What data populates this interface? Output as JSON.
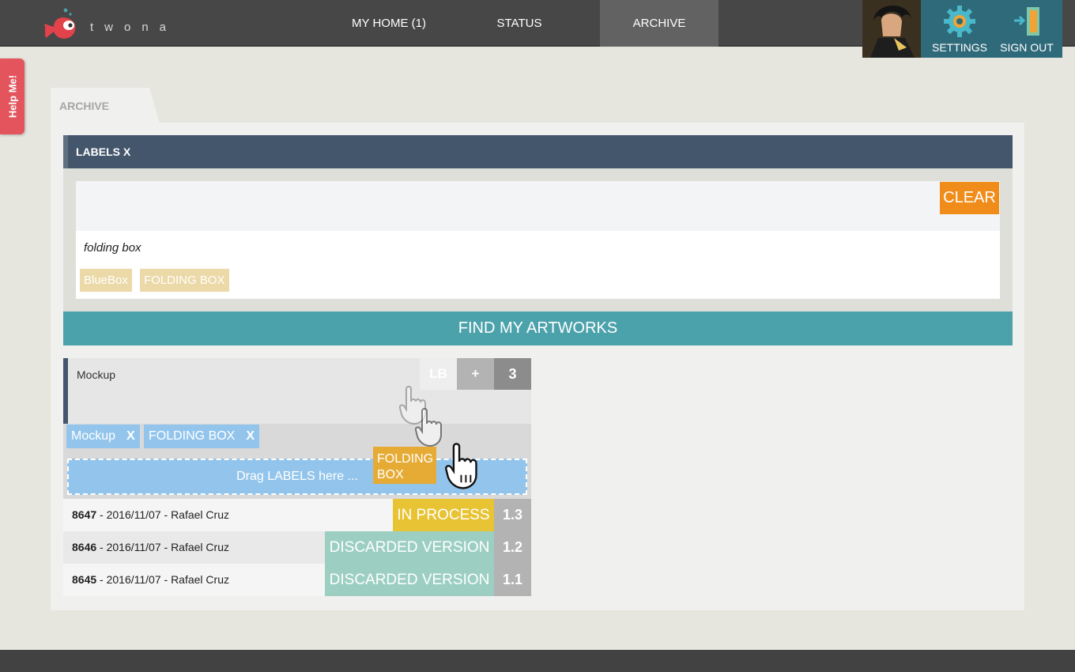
{
  "header": {
    "logo_text": "twona",
    "nav": [
      {
        "label": "MY HOME (1)"
      },
      {
        "label": "STATUS"
      },
      {
        "label": "ARCHIVE"
      }
    ],
    "settings_label": "SETTINGS",
    "signout_label": "SIGN OUT"
  },
  "help_label": "Help Me!",
  "tab_label": "ARCHIVE",
  "labels_panel": {
    "title": "LABELS X",
    "clear_label": "CLEAR",
    "search_text": "folding box",
    "chips": [
      "BlueBox",
      "FOLDING BOX"
    ]
  },
  "find_label": "FIND MY ARTWORKS",
  "card": {
    "title": "Mockup",
    "lb_label": "LB",
    "plus_label": "+",
    "count": "3",
    "labels": [
      {
        "text": "Mockup",
        "remove": "X"
      },
      {
        "text": "FOLDING BOX",
        "remove": "X"
      }
    ],
    "dropzone_label": "Drag LABELS here ...",
    "dragging_label": "FOLDING BOX",
    "versions": [
      {
        "id": "8647",
        "rest": " - 2016/11/07 - Rafael Cruz",
        "status": "IN PROCESS",
        "status_color": "#e8c334",
        "version": "1.3"
      },
      {
        "id": "8646",
        "rest": " - 2016/11/07 - Rafael Cruz",
        "status": "DISCARDED VERSION",
        "status_color": "#9ccfc2",
        "version": "1.2"
      },
      {
        "id": "8645",
        "rest": " - 2016/11/07 - Rafael Cruz",
        "status": "DISCARDED VERSION",
        "status_color": "#9ccfc2",
        "version": "1.1"
      }
    ]
  },
  "colors": {
    "header": "#474747",
    "accent_teal": "#4ca2ab",
    "labels_header": "#44566c",
    "clear_orange": "#f08c1a",
    "help_red": "#e3545c"
  }
}
